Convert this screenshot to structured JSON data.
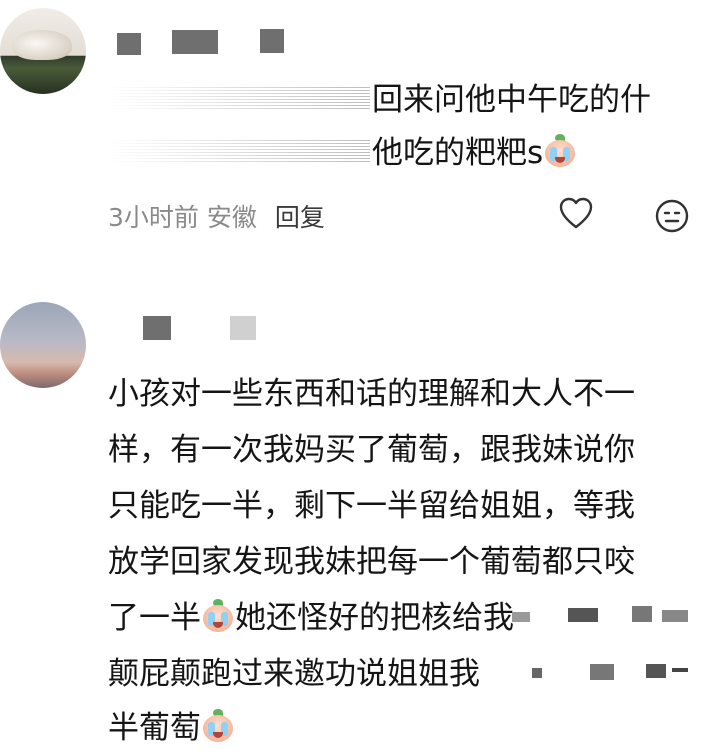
{
  "comments": [
    {
      "lines": [
        "回来问他中午吃的什",
        "他吃的粑粑s"
      ],
      "meta": {
        "time": "3小时前",
        "location": "安徽",
        "reply": "回复"
      }
    },
    {
      "lines": [
        "小孩对一些东西和话的理解和大人不一",
        "样，有一次我妈买了葡萄，跟我妹说你",
        "只能吃一半，剩下一半留给姐姐，等我",
        "放学回家发现我妹把每一个葡萄都只咬",
        "她还怪好的把核给我",
        "颠屁颠跑过来邀功说姐姐我",
        "半葡萄"
      ],
      "line5_prefix": "了一半"
    }
  ],
  "icons": [
    "heart-icon",
    "neutral-face-icon",
    "crying-emoji-icon"
  ]
}
